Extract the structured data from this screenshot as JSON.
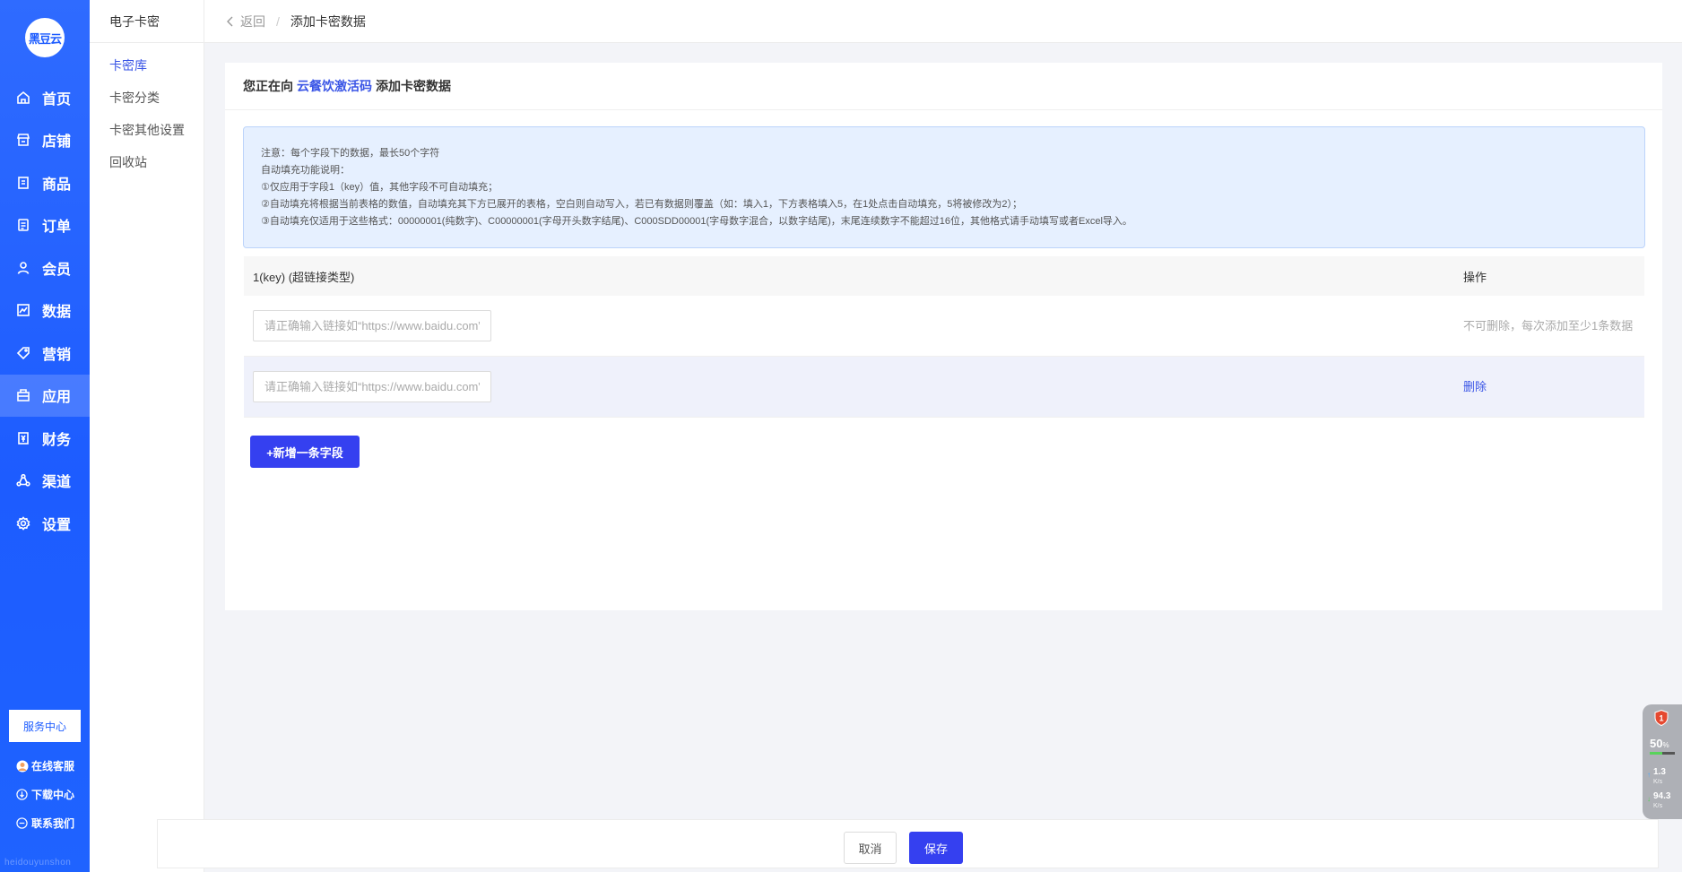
{
  "logo": {
    "text": "黑豆云"
  },
  "nav": {
    "items": [
      {
        "label": "首页",
        "icon": "home-icon"
      },
      {
        "label": "店铺",
        "icon": "store-icon"
      },
      {
        "label": "商品",
        "icon": "product-icon"
      },
      {
        "label": "订单",
        "icon": "order-icon"
      },
      {
        "label": "会员",
        "icon": "member-icon"
      },
      {
        "label": "数据",
        "icon": "chart-icon"
      },
      {
        "label": "营销",
        "icon": "tag-icon"
      },
      {
        "label": "应用",
        "icon": "app-icon",
        "active": true
      },
      {
        "label": "财务",
        "icon": "finance-icon"
      },
      {
        "label": "渠道",
        "icon": "channel-icon"
      },
      {
        "label": "设置",
        "icon": "gear-icon"
      }
    ],
    "service_center": "服务中心",
    "online_service": "在线客服",
    "download_center": "下载中心",
    "contact_us": "联系我们",
    "footer_brand": "heidouyunshon"
  },
  "subnav": {
    "title": "电子卡密",
    "items": [
      "卡密库",
      "卡密分类",
      "卡密其他设置",
      "回收站"
    ],
    "active_index": 0
  },
  "breadcrumb": {
    "back": "返回",
    "current": "添加卡密数据"
  },
  "header": {
    "prefix": "您正在向",
    "target": "云餐饮激活码",
    "suffix": "添加卡密数据"
  },
  "notice": {
    "lines": [
      "注意：每个字段下的数据，最长50个字符",
      "自动填充功能说明：",
      "①仅应用于字段1（key）值，其他字段不可自动填充；",
      "②自动填充将根据当前表格的数值，自动填充其下方已展开的表格，空白则自动写入，若已有数据则覆盖（如：填入1，下方表格填入5，在1处点击自动填充，5将被修改为2）；",
      "③自动填充仅适用于这些格式：00000001(纯数字)、C00000001(字母开头数字结尾)、C000SDD00001(字母数字混合，以数字结尾)，末尾连续数字不能超过16位，其他格式请手动填写或者Excel导入。"
    ]
  },
  "table": {
    "columns": [
      "1(key) (超链接类型)",
      "操作"
    ],
    "rows": [
      {
        "placeholder": "请正确输入链接如“https://www.baidu.com”",
        "value": "",
        "action": "不可删除，每次添加至少1条数据"
      },
      {
        "placeholder": "请正确输入链接如“https://www.baidu.com”",
        "value": "",
        "action": "删除"
      }
    ]
  },
  "add_field_button": "+新增一条字段",
  "footer": {
    "cancel": "取消",
    "save": "保存"
  },
  "monitor": {
    "badge": "1",
    "percent": "50",
    "percent_unit": "%",
    "level": 0.5,
    "upload": "1.3",
    "download": "94.3",
    "unit": "K/s"
  },
  "colors": {
    "brand": "#1d5cff",
    "primary_button": "#3540f0",
    "link": "#3a55e6"
  }
}
